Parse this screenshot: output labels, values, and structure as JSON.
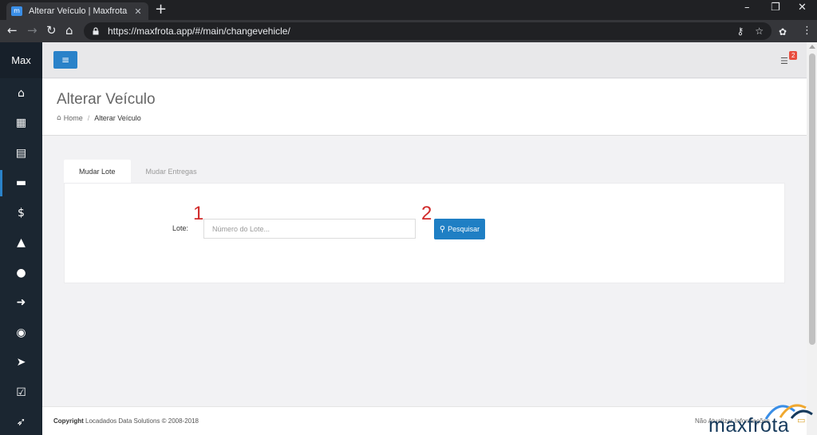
{
  "browser": {
    "tab_title": "Alterar Veículo | Maxfrota",
    "tab_close": "✕",
    "new_tab": "+",
    "url": "https://maxfrota.app/#/main/changevehicle/"
  },
  "sidebar": {
    "brand": "Max",
    "items": [
      {
        "icon": "home-icon",
        "glyph": "⌂"
      },
      {
        "icon": "dashboard-icon",
        "glyph": "▦"
      },
      {
        "icon": "map-icon",
        "glyph": "▤"
      },
      {
        "icon": "archive-icon",
        "glyph": "▬"
      },
      {
        "icon": "dollar-icon",
        "glyph": "$"
      },
      {
        "icon": "warning-icon",
        "glyph": "▲"
      },
      {
        "icon": "map-marker-icon",
        "glyph": "●"
      },
      {
        "icon": "sign-out-icon",
        "glyph": "➜"
      },
      {
        "icon": "unlock-icon",
        "glyph": "◉"
      },
      {
        "icon": "send-icon",
        "glyph": "➤"
      },
      {
        "icon": "check-square-icon",
        "glyph": "☑"
      },
      {
        "icon": "rocket-icon",
        "glyph": "➶"
      }
    ],
    "active_index": 3
  },
  "header": {
    "menu_glyph": "≡",
    "notification_count": "2"
  },
  "page": {
    "title": "Alterar Veículo",
    "breadcrumb": {
      "home": "Home",
      "separator": "/",
      "current": "Alterar Veículo"
    }
  },
  "tabs": [
    {
      "label": "Mudar Lote",
      "active": true
    },
    {
      "label": "Mudar Entregas",
      "active": false
    }
  ],
  "form": {
    "lote_label": "Lote:",
    "lote_placeholder": "Número do Lote...",
    "lote_value": "",
    "search_label": "Pesquisar"
  },
  "annotations": {
    "one": "1",
    "two": "2"
  },
  "footer": {
    "copyright_bold": "Copyright",
    "copyright_text": " Locadados Data Solutions © 2008-2018",
    "no_update": "Não Atualizar Informações"
  },
  "watermark": {
    "text": "maxfrota"
  },
  "colors": {
    "sidebar": "#1b2631",
    "primary": "#2a82c9",
    "annotation": "#d12b2b"
  }
}
